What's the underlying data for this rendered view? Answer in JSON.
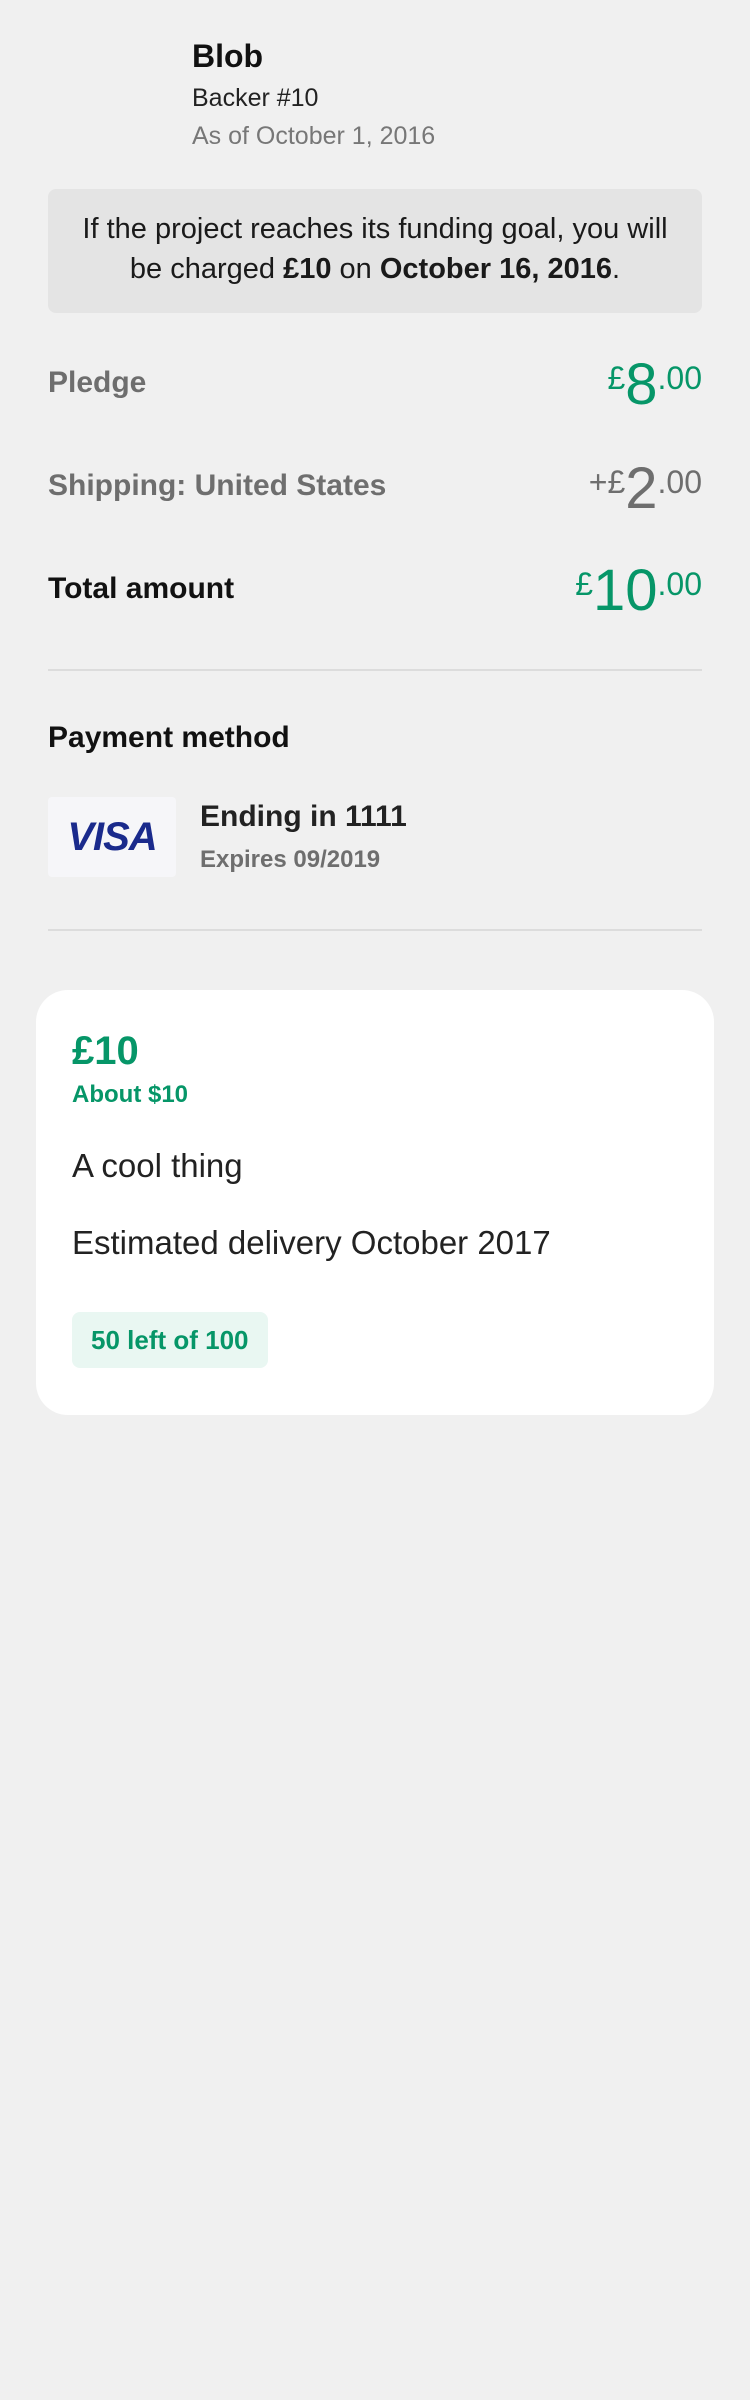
{
  "backer": {
    "name": "Blob",
    "number": "Backer #10",
    "as_of": "As of October 1, 2016"
  },
  "notice": {
    "prefix": "If the project reaches its funding goal, you will be charged ",
    "amount": "£10",
    "middle": " on ",
    "date": "October 16, 2016",
    "suffix": "."
  },
  "pledge": {
    "label": "Pledge",
    "currency": "£",
    "whole": "8",
    "decimal": ".00"
  },
  "shipping": {
    "label": "Shipping: United States",
    "currency": "+£",
    "whole": "2",
    "decimal": ".00"
  },
  "total": {
    "label": "Total amount",
    "currency": "£",
    "whole": "10",
    "decimal": ".00"
  },
  "payment": {
    "title": "Payment method",
    "card_brand": "VISA",
    "ending": "Ending in 1111",
    "expires": "Expires 09/2019"
  },
  "reward": {
    "amount": "£10",
    "converted": "About $10",
    "title": "A cool thing",
    "delivery": "Estimated delivery October 2017",
    "remaining": "50 left of 100"
  },
  "colors": {
    "accent_green": "#069668",
    "muted_text": "#6e6e6e",
    "visa_blue": "#1a2a8c",
    "background": "#f0f0f0"
  },
  "icons": {
    "card_brand_logo": "visa-logo"
  }
}
